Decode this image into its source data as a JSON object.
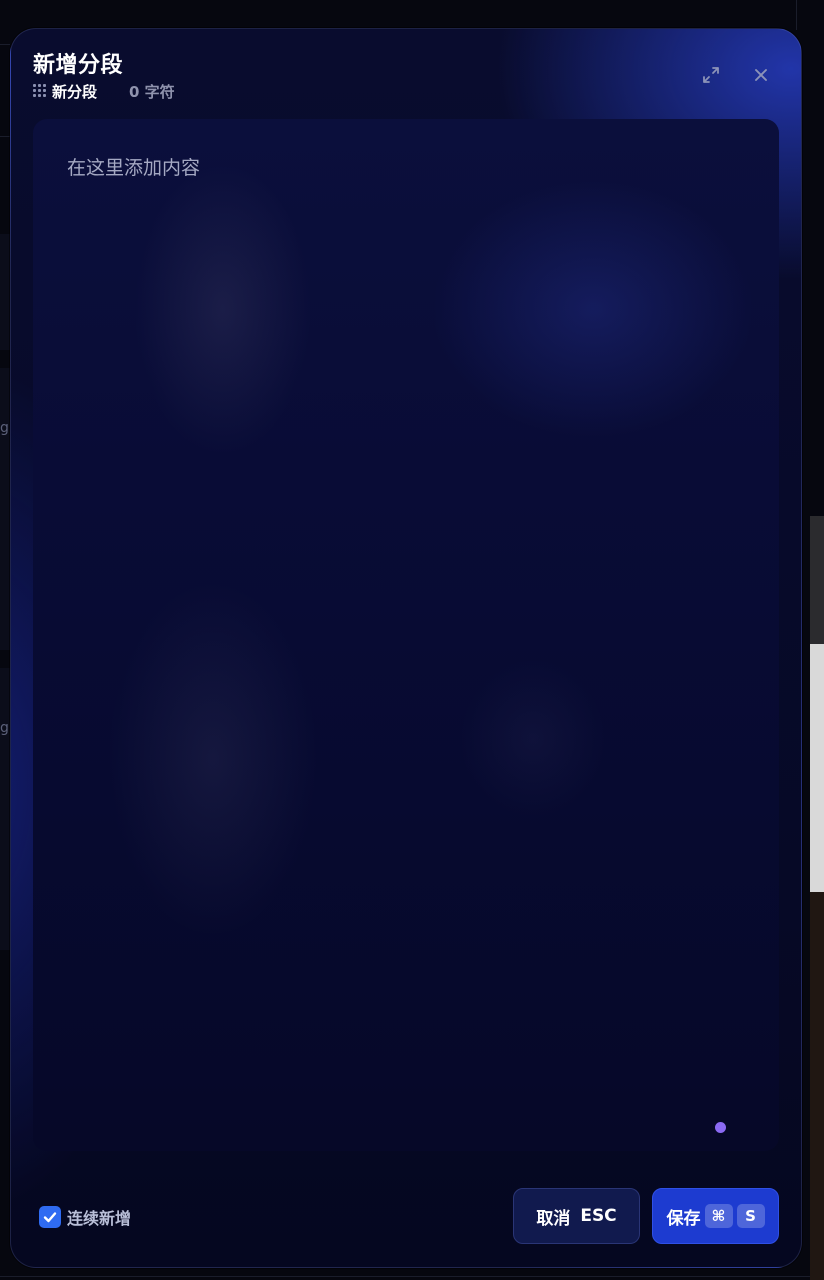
{
  "modal": {
    "title": "新增分段",
    "segment_name": "新分段",
    "char_count": "0 字符"
  },
  "editor": {
    "placeholder": "在这里添加内容",
    "value": ""
  },
  "footer": {
    "continuous_add_label": "连续新增",
    "continuous_add_checked": true,
    "cancel_label": "取消",
    "cancel_shortcut": "ESC",
    "save_label": "保存",
    "save_shortcut_modifier": "⌘",
    "save_shortcut_key": "S"
  },
  "background": {
    "left_fragment_1": "g",
    "left_fragment_2": "g"
  },
  "icons": {
    "expand": "expand-icon",
    "close": "close-icon",
    "segment": "grid-icon",
    "checkbox": "check-icon"
  },
  "colors": {
    "accent": "#1d3bd0",
    "checkbox": "#2f6bf2",
    "dot": "#8b6af3"
  }
}
